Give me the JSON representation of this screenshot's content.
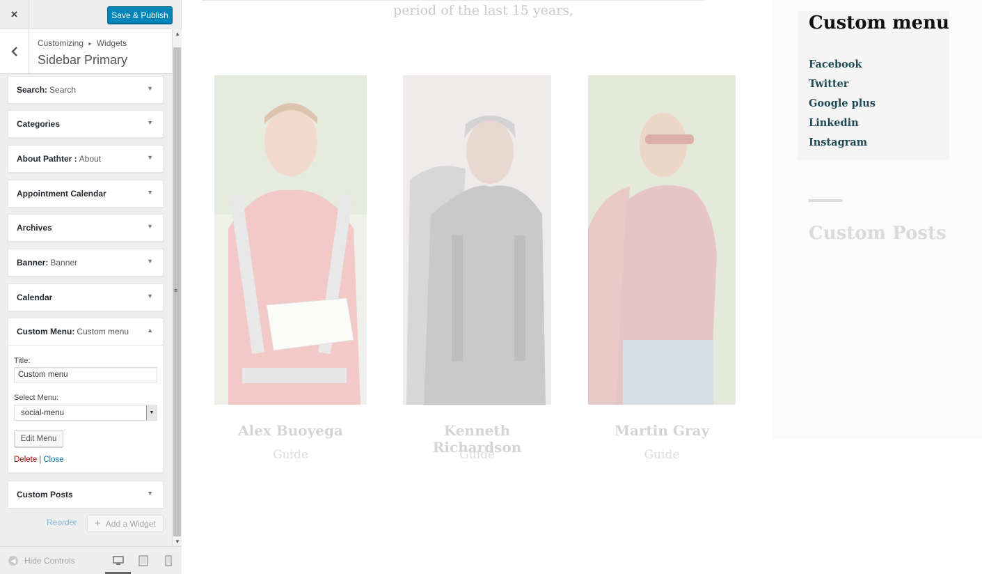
{
  "topbar": {
    "close_glyph": "×",
    "save_label": "Save & Publish"
  },
  "section": {
    "back_glyph": "‹",
    "breadcrumb_parent": "Customizing",
    "breadcrumb_sep": "▸",
    "breadcrumb_child": "Widgets",
    "title": "Sidebar Primary"
  },
  "widgets": [
    {
      "name": "Search:",
      "sub": "Search",
      "arrow": "▼"
    },
    {
      "name": "Categories",
      "sub": "",
      "arrow": "▼"
    },
    {
      "name": "About Pathter :",
      "sub": "About",
      "arrow": "▼"
    },
    {
      "name": "Appointment Calendar",
      "sub": "",
      "arrow": "▼"
    },
    {
      "name": "Archives",
      "sub": "",
      "arrow": "▼"
    },
    {
      "name": "Banner:",
      "sub": "Banner",
      "arrow": "▼"
    },
    {
      "name": "Calendar",
      "sub": "",
      "arrow": "▼"
    },
    {
      "name": "Custom Menu:",
      "sub": "Custom menu",
      "arrow": "▲"
    },
    {
      "name": "Custom Posts",
      "sub": "",
      "arrow": "▼"
    }
  ],
  "custom_menu_form": {
    "title_label": "Title:",
    "title_value": "Custom menu",
    "select_label": "Select Menu:",
    "select_value": "social-menu",
    "edit_menu_label": "Edit Menu",
    "delete_label": "Delete",
    "separator": "|",
    "close_label": "Close"
  },
  "actions": {
    "reorder_label": "Reorder",
    "add_widget_label": "Add a Widget",
    "add_icon": "+"
  },
  "footer": {
    "hide_controls_label": "Hide Controls",
    "hide_icon": "◀",
    "devices": [
      "desktop-icon",
      "tablet-icon",
      "mobile-icon"
    ]
  },
  "preview": {
    "intro_text": "period of the last 15 years,",
    "team": [
      {
        "name": "Alex Buoyega",
        "role": "Guide"
      },
      {
        "name": "Kenneth Richardson",
        "role": "Guide"
      },
      {
        "name": "Martin Gray",
        "role": "Guide"
      }
    ],
    "custom_menu": {
      "title": "Custom menu",
      "links": [
        "Facebook",
        "Twitter",
        "Google plus",
        "Linkedin",
        "Instagram"
      ]
    },
    "custom_posts_title": "Custom Posts"
  },
  "colors": {
    "primary_button": "#0085ba",
    "link": "#0073aa",
    "delete": "#aa0000",
    "menu_link": "#1e4a56"
  }
}
